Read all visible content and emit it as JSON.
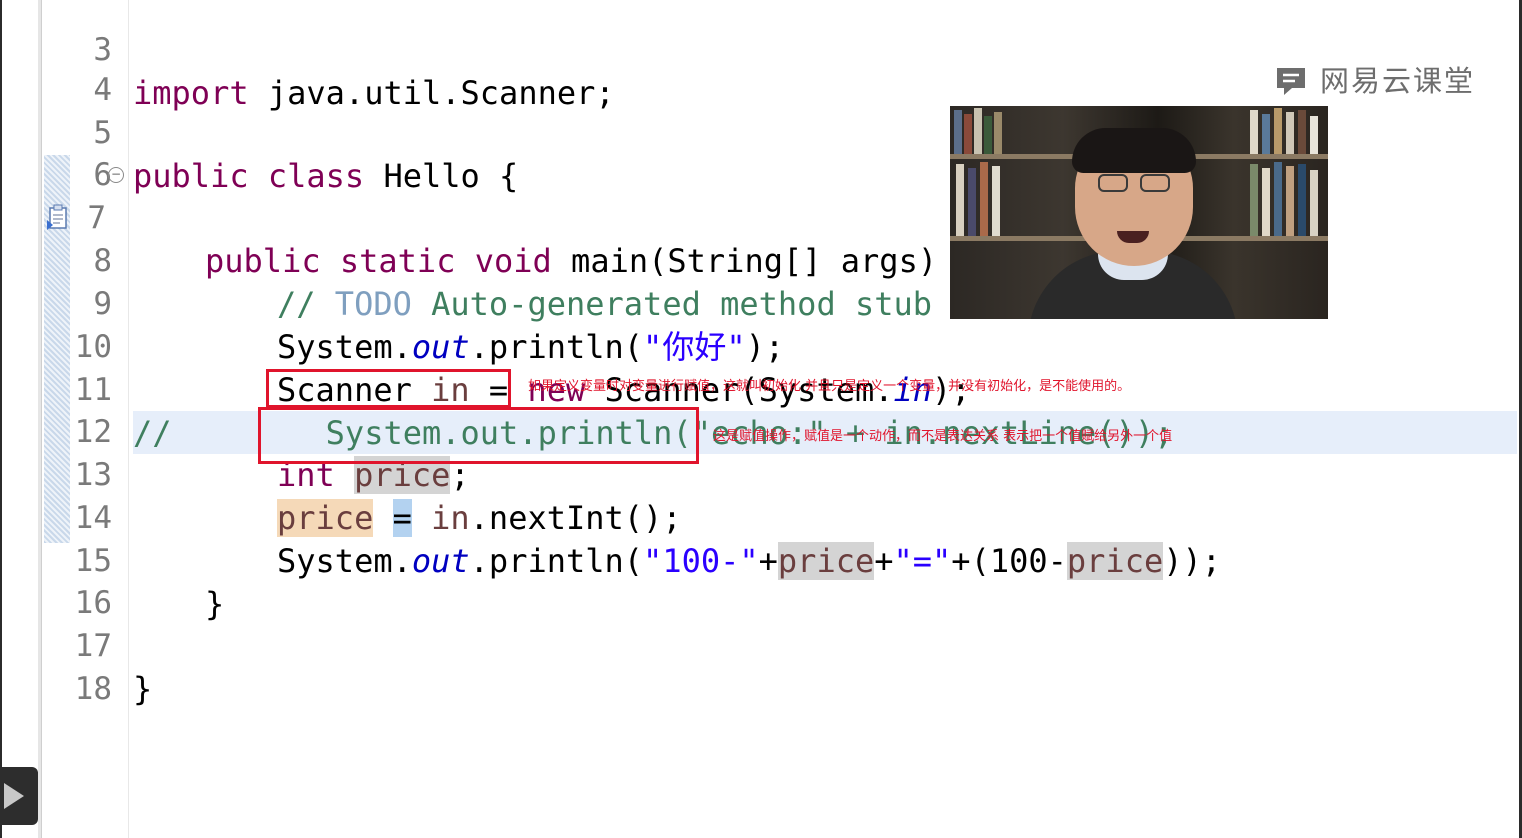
{
  "editor": {
    "lines": [
      {
        "num": "3",
        "code": [
          "import",
          " java.util.Scanner;"
        ]
      },
      {
        "num": "4"
      },
      {
        "num": "5",
        "code": [
          "public",
          " ",
          "class",
          " Hello {"
        ]
      },
      {
        "num": "6"
      },
      {
        "num": "7",
        "code": [
          "public",
          " ",
          "static",
          " ",
          "void",
          " main(String[] args) {"
        ]
      },
      {
        "num": "8",
        "code": [
          "// ",
          "TODO",
          " Auto-generated method stub"
        ]
      },
      {
        "num": "9",
        "code": [
          "System.",
          "out",
          ".println(",
          "\"你好\"",
          ");"
        ]
      },
      {
        "num": "10",
        "code": [
          "Scanner ",
          "in",
          " = ",
          "new",
          " Scanner(System.",
          "in",
          ");"
        ]
      },
      {
        "num": "11",
        "code": [
          "//        System.out.println(\"echo:\" + in.nextLine());"
        ]
      },
      {
        "num": "12",
        "code": [
          "int",
          " ",
          "price",
          ";"
        ]
      },
      {
        "num": "13",
        "code": [
          "price",
          " ",
          "=",
          " ",
          "in",
          ".nextInt();"
        ]
      },
      {
        "num": "14",
        "code": [
          "System.",
          "out",
          ".println(",
          "\"100-\"",
          "+",
          "price",
          "+",
          "\"=\"",
          "+(100-",
          "price",
          "));"
        ]
      },
      {
        "num": "15",
        "code": [
          "}"
        ]
      },
      {
        "num": "16"
      },
      {
        "num": "17",
        "code": [
          "}"
        ]
      },
      {
        "num": "18"
      }
    ]
  },
  "annotations": {
    "note_line12": "如果定义变量时对变量进行赋值，这就叫初始化  并且只是定义一个变量，并没有初始化，是不能使用的。",
    "note_line13": "这是赋值操作，赋值是一个动作，而不是表达关系  表示把一个值赋给另外一个值",
    "color": "#e0142c"
  },
  "brand": {
    "name": "网易云课堂",
    "icon": "chat-bubble-logo-icon"
  },
  "player": {
    "play_icon": "play-icon"
  },
  "theme": {
    "keyword": "#7f0055",
    "string": "#2a00ff",
    "comment": "#3f7f5f",
    "field": "#0000c0",
    "current_line": "#e6eefa"
  }
}
